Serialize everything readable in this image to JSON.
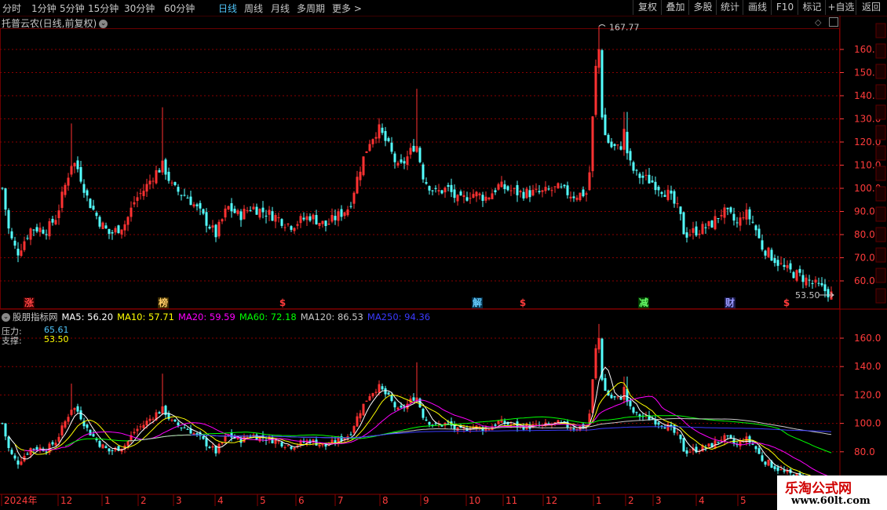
{
  "toolbar": {
    "periods": [
      "分时",
      "1分钟",
      "5分钟",
      "15分钟",
      "30分钟",
      "60分钟",
      "日线",
      "周线",
      "月线",
      "多周期",
      "更多"
    ],
    "active_period": "日线",
    "more_arrow": ">",
    "buttons": [
      "复权",
      "叠加",
      "多股",
      "统计",
      "画线",
      "F10",
      "标记",
      "+自选",
      "返回"
    ]
  },
  "main_chart": {
    "title": "托普云农(日线,前复权)",
    "price_axis": [
      "160.0",
      "150.0",
      "140.0",
      "130.0",
      "120.0",
      "110.0",
      "100.0",
      "90.0",
      "80.0",
      "70.0",
      "60.0"
    ],
    "price_axis_values": [
      160,
      150,
      140,
      130,
      120,
      110,
      100,
      90,
      80,
      70,
      60
    ],
    "high_label": "167.77",
    "low_label": "53.50",
    "colors": {
      "up": "#ff3232",
      "down": "#54ffff",
      "grid": "#8a0000",
      "axis": "#ff3b3b"
    }
  },
  "markers": [
    {
      "text": "涨",
      "color": "#ff4444",
      "bg": "#3a0000"
    },
    {
      "text": "榜",
      "color": "#ffcc66",
      "bg": "#3a2a00"
    },
    {
      "text": "$",
      "color": "#ff3b3b",
      "bg": ""
    },
    {
      "text": "解",
      "color": "#66ccff",
      "bg": "#00304a"
    },
    {
      "text": "$",
      "color": "#ff3b3b",
      "bg": ""
    },
    {
      "text": "减",
      "color": "#66ff66",
      "bg": "#003a00"
    },
    {
      "text": "财",
      "color": "#9999ff",
      "bg": "#1a1a4a"
    },
    {
      "text": "$",
      "color": "#ff3b3b",
      "bg": ""
    }
  ],
  "indicator": {
    "name": "股朋指标网",
    "ma": [
      {
        "label": "MA5: 56.20",
        "color": "#ffffff"
      },
      {
        "label": "MA10: 57.71",
        "color": "#ffff00"
      },
      {
        "label": "MA20: 59.59",
        "color": "#ff00ff"
      },
      {
        "label": "MA60: 72.18",
        "color": "#00ff00"
      },
      {
        "label": "MA120: 86.53",
        "color": "#c8c8c8"
      },
      {
        "label": "MA250: 94.36",
        "color": "#3a3aff"
      }
    ],
    "pressure_label": "压力:",
    "pressure_value": "65.61",
    "support_label": "支撑:",
    "support_value": "53.50",
    "price_axis": [
      "160.0",
      "140.0",
      "120.0",
      "100.0",
      "80.0"
    ],
    "price_axis_values": [
      160,
      140,
      120,
      100,
      80
    ]
  },
  "time_axis": [
    "2024年",
    "12",
    "1",
    "2",
    "3",
    "4",
    "5",
    "6",
    "7",
    "8",
    "9",
    "10",
    "11",
    "12",
    "1",
    "2",
    "3",
    "4",
    "5"
  ],
  "watermark": {
    "line1": "乐淘公式网",
    "line2": "www.60lt.com"
  }
}
